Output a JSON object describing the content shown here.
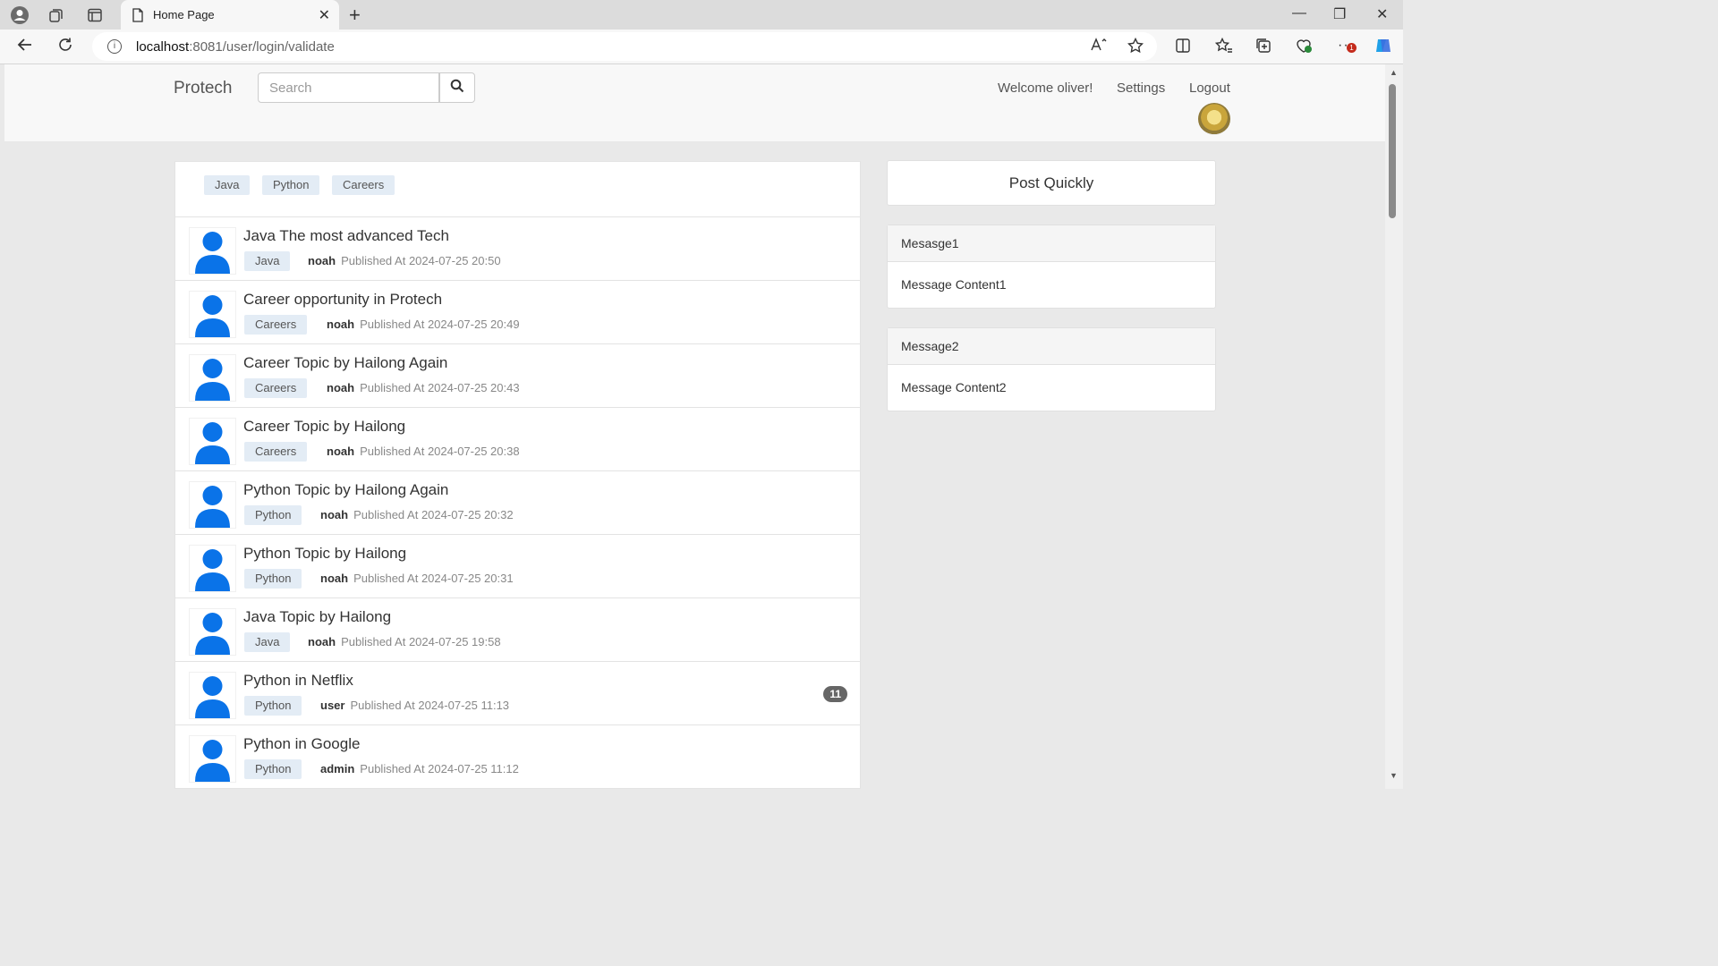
{
  "browser": {
    "tab_title": "Home Page",
    "url_host": "localhost",
    "url_path": ":8081/user/login/validate",
    "notification_count": "1"
  },
  "header": {
    "brand": "Protech",
    "search_placeholder": "Search",
    "welcome": "Welcome oliver!",
    "settings": "Settings",
    "logout": "Logout"
  },
  "filters": [
    "Java",
    "Python",
    "Careers"
  ],
  "topics": [
    {
      "title": "Java The most advanced Tech",
      "tag": "Java",
      "author": "noah",
      "published": "Published At 2024-07-25 20:50",
      "count": ""
    },
    {
      "title": "Career opportunity in Protech",
      "tag": "Careers",
      "author": "noah",
      "published": "Published At 2024-07-25 20:49",
      "count": ""
    },
    {
      "title": "Career Topic by Hailong Again",
      "tag": "Careers",
      "author": "noah",
      "published": "Published At 2024-07-25 20:43",
      "count": ""
    },
    {
      "title": "Career Topic by Hailong",
      "tag": "Careers",
      "author": "noah",
      "published": "Published At 2024-07-25 20:38",
      "count": ""
    },
    {
      "title": "Python Topic by Hailong Again",
      "tag": "Python",
      "author": "noah",
      "published": "Published At 2024-07-25 20:32",
      "count": ""
    },
    {
      "title": "Python Topic by Hailong",
      "tag": "Python",
      "author": "noah",
      "published": "Published At 2024-07-25 20:31",
      "count": ""
    },
    {
      "title": "Java Topic by Hailong",
      "tag": "Java",
      "author": "noah",
      "published": "Published At 2024-07-25 19:58",
      "count": ""
    },
    {
      "title": "Python in Netflix",
      "tag": "Python",
      "author": "user",
      "published": "Published At 2024-07-25 11:13",
      "count": "11"
    },
    {
      "title": "Python in Google",
      "tag": "Python",
      "author": "admin",
      "published": "Published At 2024-07-25 11:12",
      "count": ""
    }
  ],
  "sidebar": {
    "post_quickly": "Post Quickly",
    "messages": [
      {
        "title": "Mesasge1",
        "content": "Message Content1"
      },
      {
        "title": "Message2",
        "content": "Message Content2"
      }
    ]
  },
  "colors": {
    "avatar_blue": "#0a73e8",
    "tag_bg": "#e3ecf5",
    "badge_bg": "#666666"
  }
}
